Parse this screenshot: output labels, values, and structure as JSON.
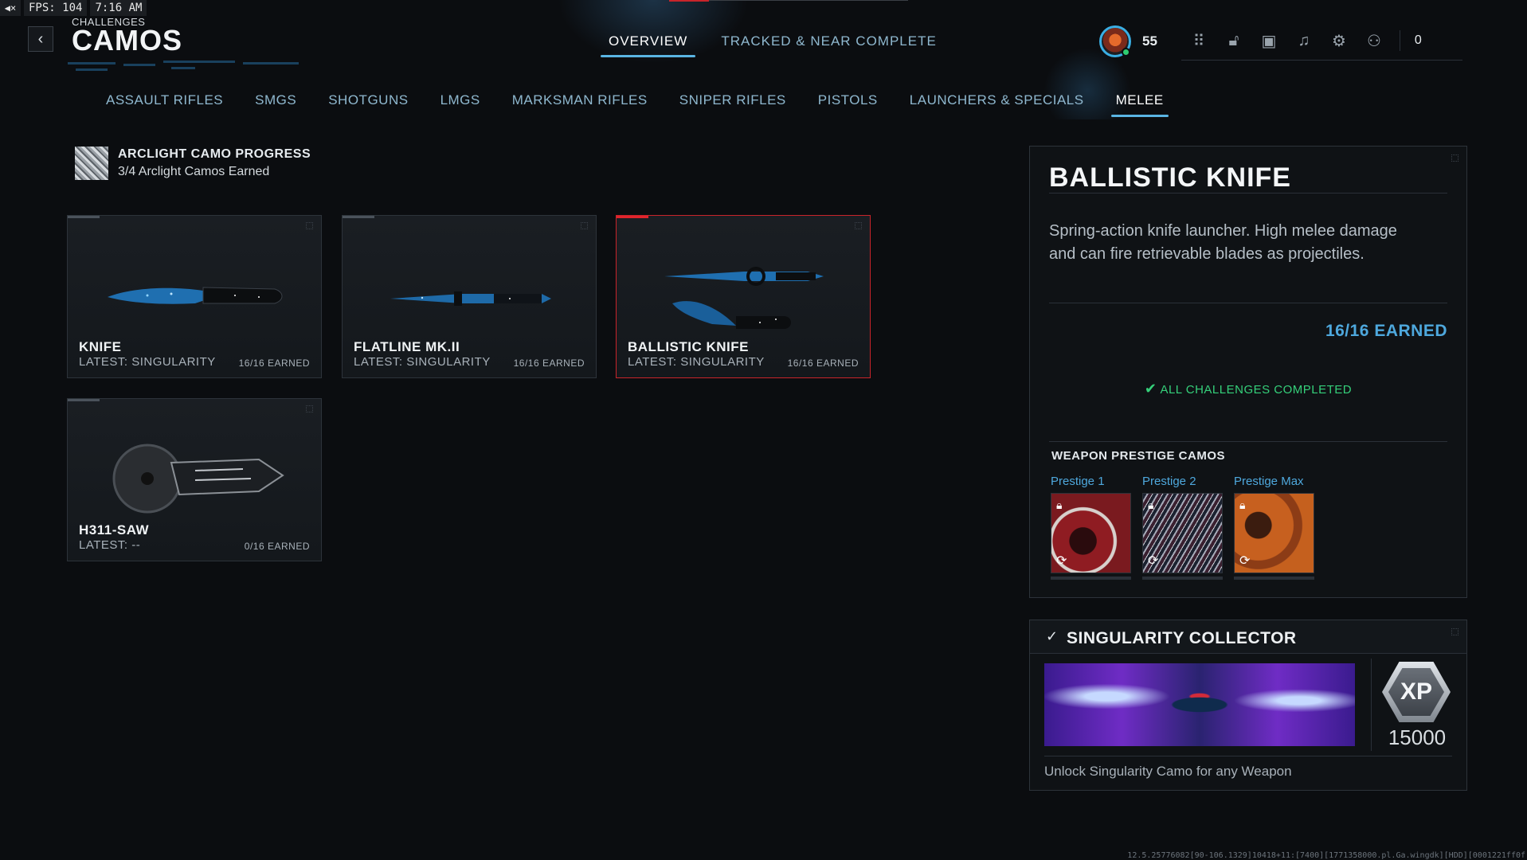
{
  "status": {
    "fps_label": "FPS: 104",
    "clock": "7:16 AM"
  },
  "header": {
    "breadcrumb": "CHALLENGES",
    "title": "CAMOS"
  },
  "top_tabs": [
    {
      "label": "OVERVIEW",
      "active": true
    },
    {
      "label": "TRACKED & NEAR COMPLETE",
      "active": false
    }
  ],
  "player": {
    "level": "55",
    "notification_count": "0"
  },
  "weapon_tabs": [
    {
      "label": "ASSAULT RIFLES",
      "active": false
    },
    {
      "label": "SMGS",
      "active": false
    },
    {
      "label": "SHOTGUNS",
      "active": false
    },
    {
      "label": "LMGS",
      "active": false
    },
    {
      "label": "MARKSMAN RIFLES",
      "active": false
    },
    {
      "label": "SNIPER RIFLES",
      "active": false
    },
    {
      "label": "PISTOLS",
      "active": false
    },
    {
      "label": "LAUNCHERS & SPECIALS",
      "active": false
    },
    {
      "label": "MELEE",
      "active": true
    }
  ],
  "arclight": {
    "title": "ARCLIGHT CAMO PROGRESS",
    "subtitle": "3/4 Arclight Camos Earned"
  },
  "weapons": [
    {
      "name": "KNIFE",
      "latest": "LATEST: SINGULARITY",
      "earned": "16/16 EARNED",
      "selected": false
    },
    {
      "name": "FLATLINE MK.II",
      "latest": "LATEST: SINGULARITY",
      "earned": "16/16 EARNED",
      "selected": false
    },
    {
      "name": "BALLISTIC KNIFE",
      "latest": "LATEST: SINGULARITY",
      "earned": "16/16 EARNED",
      "selected": true
    },
    {
      "name": "H311-SAW",
      "latest": "LATEST: --",
      "earned": "0/16 EARNED",
      "selected": false
    }
  ],
  "detail": {
    "title": "BALLISTIC KNIFE",
    "description": "Spring-action knife launcher. High melee damage and can fire retrievable blades as projectiles.",
    "earned": "16/16 EARNED",
    "completed": "ALL CHALLENGES COMPLETED",
    "prestige_heading": "WEAPON PRESTIGE CAMOS",
    "prestige": [
      {
        "label": "Prestige 1",
        "locked": true
      },
      {
        "label": "Prestige 2",
        "locked": true
      },
      {
        "label": "Prestige Max",
        "locked": true
      }
    ]
  },
  "reward": {
    "title": "SINGULARITY COLLECTOR",
    "xp_label": "XP",
    "xp_amount": "15000",
    "description": "Unlock Singularity Camo for any Weapon"
  },
  "build_string": "12.5.25776082[90-106.1329]10418+11:[7400][1771358000.pl.Ga.wingdk][HDD][0001221ff0f",
  "colors": {
    "accent_blue": "#4ea8dd",
    "selection_red": "#c8242a",
    "complete_green": "#35d07a"
  },
  "icons": [
    "mute-icon",
    "back-icon",
    "grid-icon",
    "unlock-icon",
    "camera-icon",
    "bell-icon",
    "gear-icon",
    "social-icon",
    "check-icon",
    "lock-icon"
  ]
}
